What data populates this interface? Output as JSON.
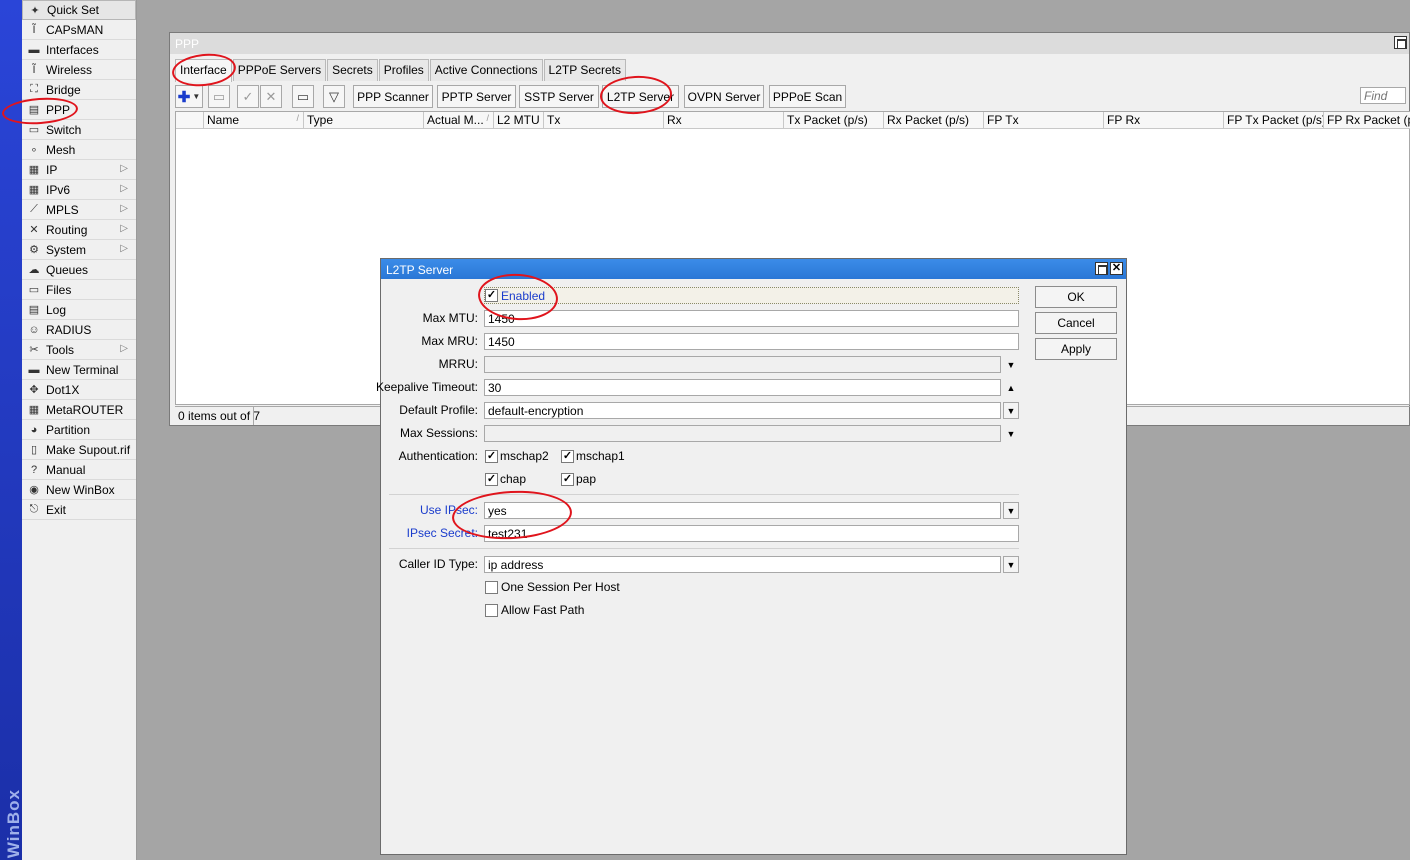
{
  "brand": {
    "text": "WinBox"
  },
  "menu": {
    "items": [
      {
        "label": "Quick Set",
        "icon": "quick-set-icon",
        "glyph": "✦",
        "arrow": false
      },
      {
        "label": "CAPsMAN",
        "icon": "capsman-icon",
        "glyph": "Ĩ",
        "arrow": false
      },
      {
        "label": "Interfaces",
        "icon": "interfaces-icon",
        "glyph": "▬",
        "arrow": false
      },
      {
        "label": "Wireless",
        "icon": "wireless-icon",
        "glyph": "Ĩ",
        "arrow": false
      },
      {
        "label": "Bridge",
        "icon": "bridge-icon",
        "glyph": "⛶",
        "arrow": false
      },
      {
        "label": "PPP",
        "icon": "ppp-icon",
        "glyph": "▤",
        "arrow": false
      },
      {
        "label": "Switch",
        "icon": "switch-icon",
        "glyph": "▭",
        "arrow": false
      },
      {
        "label": "Mesh",
        "icon": "mesh-icon",
        "glyph": "∘",
        "arrow": false
      },
      {
        "label": "IP",
        "icon": "ip-icon",
        "glyph": "▦",
        "arrow": true
      },
      {
        "label": "IPv6",
        "icon": "ipv6-icon",
        "glyph": "▦",
        "arrow": true
      },
      {
        "label": "MPLS",
        "icon": "mpls-icon",
        "glyph": "⟋",
        "arrow": true
      },
      {
        "label": "Routing",
        "icon": "routing-icon",
        "glyph": "✕",
        "arrow": true
      },
      {
        "label": "System",
        "icon": "system-icon",
        "glyph": "⚙",
        "arrow": true
      },
      {
        "label": "Queues",
        "icon": "queues-icon",
        "glyph": "☁",
        "arrow": false
      },
      {
        "label": "Files",
        "icon": "files-icon",
        "glyph": "▭",
        "arrow": false
      },
      {
        "label": "Log",
        "icon": "log-icon",
        "glyph": "▤",
        "arrow": false
      },
      {
        "label": "RADIUS",
        "icon": "radius-icon",
        "glyph": "☺",
        "arrow": false
      },
      {
        "label": "Tools",
        "icon": "tools-icon",
        "glyph": "✂",
        "arrow": true
      },
      {
        "label": "New Terminal",
        "icon": "terminal-icon",
        "glyph": "▬",
        "arrow": false
      },
      {
        "label": "Dot1X",
        "icon": "dot1x-icon",
        "glyph": "✥",
        "arrow": false
      },
      {
        "label": "MetaROUTER",
        "icon": "metarouter-icon",
        "glyph": "▦",
        "arrow": false
      },
      {
        "label": "Partition",
        "icon": "partition-icon",
        "glyph": "◕",
        "arrow": false
      },
      {
        "label": "Make Supout.rif",
        "icon": "supout-icon",
        "glyph": "▯",
        "arrow": false
      },
      {
        "label": "Manual",
        "icon": "manual-icon",
        "glyph": "?",
        "arrow": false
      },
      {
        "label": "New WinBox",
        "icon": "winbox-icon",
        "glyph": "◉",
        "arrow": false
      },
      {
        "label": "Exit",
        "icon": "exit-icon",
        "glyph": "⎋",
        "arrow": false
      }
    ]
  },
  "ppp_window": {
    "title": "PPP",
    "tabs": [
      "Interface",
      "PPPoE Servers",
      "Secrets",
      "Profiles",
      "Active Connections",
      "L2TP Secrets"
    ],
    "active_tab": "Interface",
    "toolbar": {
      "buttons": [
        "PPP Scanner",
        "PPTP Server",
        "SSTP Server",
        "L2TP Server",
        "OVPN Server",
        "PPPoE Scan"
      ],
      "find_placeholder": "Find"
    },
    "columns": [
      "",
      "Name",
      "Type",
      "Actual M...",
      "L2 MTU",
      "Tx",
      "Rx",
      "Tx Packet (p/s)",
      "Rx Packet (p/s)",
      "FP Tx",
      "FP Rx",
      "FP Tx Packet (p/s)",
      "FP Rx Packet (p/s)"
    ],
    "status": "0 items out of 7"
  },
  "l2tp_dialog": {
    "title": "L2TP Server",
    "enabled": {
      "label": "Enabled",
      "checked": true
    },
    "max_mtu": {
      "label": "Max MTU:",
      "value": "1450"
    },
    "max_mru": {
      "label": "Max MRU:",
      "value": "1450"
    },
    "mrru": {
      "label": "MRRU:",
      "value": ""
    },
    "keepalive": {
      "label": "Keepalive Timeout:",
      "value": "30"
    },
    "default_profile": {
      "label": "Default Profile:",
      "value": "default-encryption"
    },
    "max_sessions": {
      "label": "Max Sessions:",
      "value": ""
    },
    "authentication": {
      "label": "Authentication:",
      "options": [
        {
          "label": "mschap2",
          "checked": true
        },
        {
          "label": "mschap1",
          "checked": true
        },
        {
          "label": "chap",
          "checked": true
        },
        {
          "label": "pap",
          "checked": true
        }
      ]
    },
    "use_ipsec": {
      "label": "Use IPsec:",
      "value": "yes"
    },
    "ipsec_secret": {
      "label": "IPsec Secret:",
      "value": "test231"
    },
    "caller_id_type": {
      "label": "Caller ID Type:",
      "value": "ip address"
    },
    "one_session_per_host": {
      "label": "One Session Per Host",
      "checked": false
    },
    "allow_fast_path": {
      "label": "Allow Fast Path",
      "checked": false
    },
    "buttons": {
      "ok": "OK",
      "cancel": "Cancel",
      "apply": "Apply"
    }
  },
  "colors": {
    "annotation": "#e0141c",
    "blue_label": "#1a3ccc",
    "dialog_title": "#2a77d6"
  }
}
